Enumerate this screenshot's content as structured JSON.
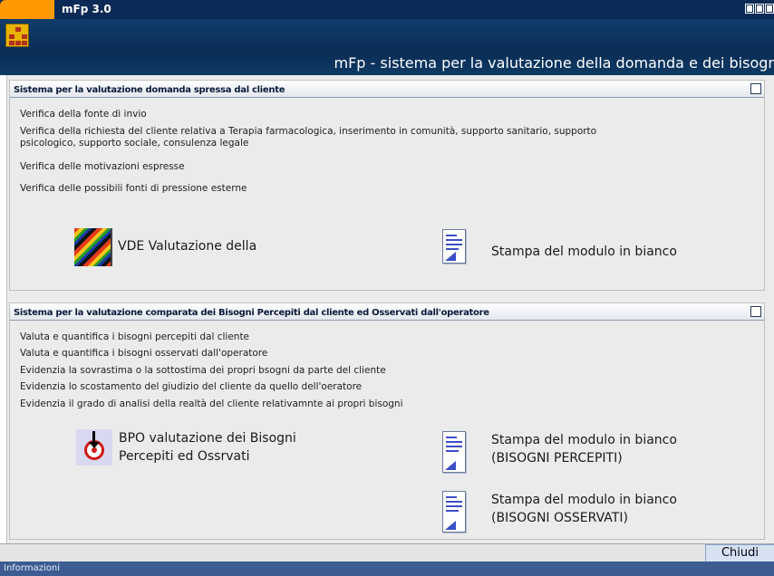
{
  "window": {
    "title": "mFp 3.0"
  },
  "header": {
    "subtitle": "mFp - sistema per la valutazione della domanda e dei bisogni"
  },
  "panel1": {
    "title": "Sistema per la valutazione domanda spressa dal cliente",
    "items": [
      "Verifica della fonte di invio",
      "Verifica della richiesta del cliente relativa a Terapia farmacologica, inserimento in comunità, supporto sanitario, supporto",
      "psicologico, supporto sociale, consulenza legale",
      "Verifica delle motivazioni espresse",
      "Verifica delle possibili fonti di pressione esterne"
    ],
    "action_vde": "VDE Valutazione della",
    "action_print": "Stampa del modulo in bianco"
  },
  "panel2": {
    "title": "Sistema per la valutazione comparata dei Bisogni Percepiti dal cliente ed Osservati dall'operatore",
    "items": [
      "Valuta e quantifica i bisogni percepiti dal cliente",
      "Valuta e quantifica i bisogni osservati dall'operatore",
      "Evidenzia la sovrastima o la sottostima dei propri bsogni da parte del cliente",
      "Evidenzia lo scostamento del giudizio del cliente da quello dell'oeratore",
      "Evidenzia il grado di analisi della realtà del cliente relativamnte ai propri bisogni"
    ],
    "action_bpo_line1": "BPO valutazione dei Bisogni",
    "action_bpo_line2": "Percepiti ed Ossrvati",
    "action_print_percepiti_line1": "Stampa del modulo in bianco",
    "action_print_percepiti_line2": "(BISOGNI PERCEPITI)",
    "action_print_osservati_line1": "Stampa del modulo in bianco",
    "action_print_osservati_line2": "(BISOGNI OSSERVATI)"
  },
  "footer": {
    "close_label": "Chiudi",
    "status": "Informazioni"
  },
  "colors": {
    "titlebar": "#0b2a55",
    "accent": "#ff9900",
    "statusbar": "#3c5c92"
  }
}
